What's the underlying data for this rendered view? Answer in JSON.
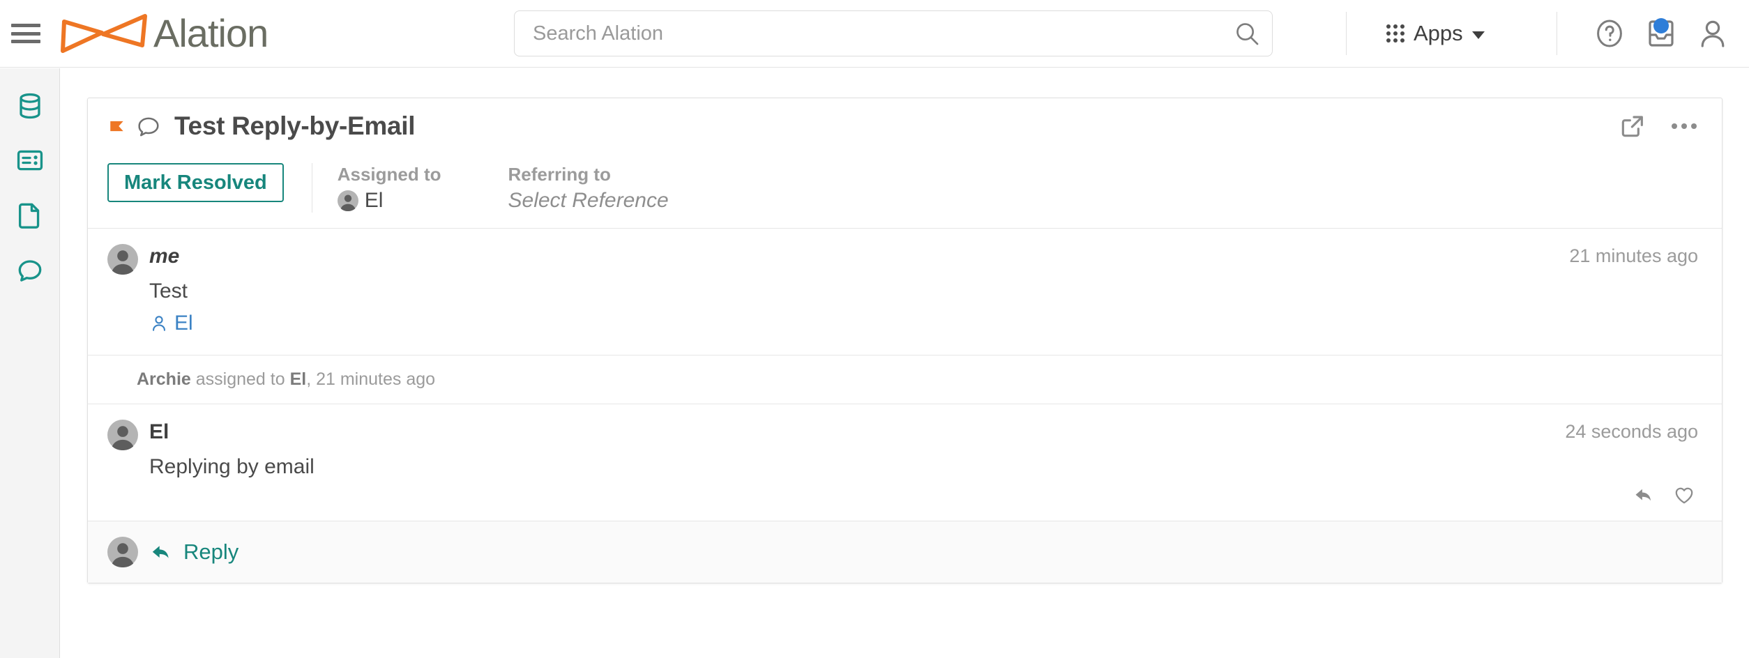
{
  "header": {
    "menu_icon": "hamburger-icon",
    "brand_name": "Alation",
    "brand_logo_icon": "alation-bowtie-logo",
    "search": {
      "placeholder": "Search Alation",
      "value": "",
      "icon": "search-icon"
    },
    "apps": {
      "label": "Apps",
      "grid_icon": "apps-grid-icon",
      "caret_icon": "chevron-down-icon"
    },
    "icons": [
      {
        "name": "help-icon",
        "title": "Help"
      },
      {
        "name": "inbox-icon",
        "title": "Inbox",
        "badge": true
      },
      {
        "name": "user-account-icon",
        "title": "Account"
      }
    ],
    "accent_orange": "#EE7624",
    "brand_text_color": "#6A6D62",
    "notification_dot_color": "#2F7ED8"
  },
  "sidebar": {
    "items": [
      {
        "name": "sidebar-item-sources",
        "icon": "database-icon"
      },
      {
        "name": "sidebar-item-articles",
        "icon": "article-card-icon"
      },
      {
        "name": "sidebar-item-documents",
        "icon": "document-icon"
      },
      {
        "name": "sidebar-item-conversations",
        "icon": "conversation-bubble-icon"
      }
    ],
    "icon_color": "#18938A"
  },
  "conversation": {
    "flag_icon": "orange-flag-icon",
    "type_icon": "conversation-bubble-icon",
    "title": "Test Reply-by-Email",
    "open_in_new_icon": "external-link-icon",
    "more_icon": "more-options-icon",
    "actions": {
      "resolve_label": "Mark Resolved",
      "assigned_to_label": "Assigned to",
      "assigned_to_value": "El",
      "referring_to_label": "Referring to",
      "referring_to_value": "Select Reference"
    },
    "messages": [
      {
        "author": "me",
        "author_italic": true,
        "text": "Test",
        "mention": "El",
        "mention_icon": "person-icon",
        "timestamp": "21 minutes ago",
        "has_actions": false
      },
      {
        "author": "El",
        "author_italic": false,
        "text": "Replying by email",
        "mention": "",
        "timestamp": "24 seconds ago",
        "has_actions": true,
        "reply_icon": "reply-arrow-icon",
        "like_icon": "heart-icon"
      }
    ],
    "activity": {
      "actor": "Archie",
      "verb": " assigned to ",
      "target": "El",
      "time": ", 21 minutes ago"
    },
    "footer": {
      "avatar_icon": "avatar-icon",
      "reply_icon": "reply-arrow-icon",
      "reply_label": "Reply"
    },
    "teal": "#17867C",
    "link_blue": "#3B82C4"
  }
}
